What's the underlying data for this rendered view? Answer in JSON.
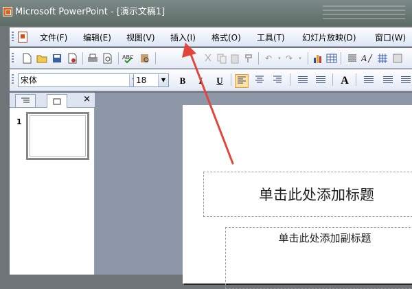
{
  "window": {
    "title": "Microsoft PowerPoint - [演示文稿1]"
  },
  "menubar": {
    "items": [
      "文件(F)",
      "编辑(E)",
      "视图(V)",
      "插入(I)",
      "格式(O)",
      "工具(T)",
      "幻灯片放映(D)",
      "窗口(W)"
    ]
  },
  "toolbar": {
    "font_name": "宋体",
    "font_size": "18",
    "bold": "B",
    "italic": "I",
    "underline": "U",
    "grow_font": "A"
  },
  "left_pane": {
    "tab_outline_icon": "outline-icon",
    "tab_slides_icon": "slides-icon",
    "close": "×",
    "slide_number": "1"
  },
  "slide": {
    "title_placeholder": "单击此处添加标题",
    "subtitle_placeholder": "单击此处添加副标题"
  },
  "colors": {
    "annotation_arrow": "#e0463c",
    "menubar": "#e9eef8",
    "workspace": "#8d97a8"
  }
}
